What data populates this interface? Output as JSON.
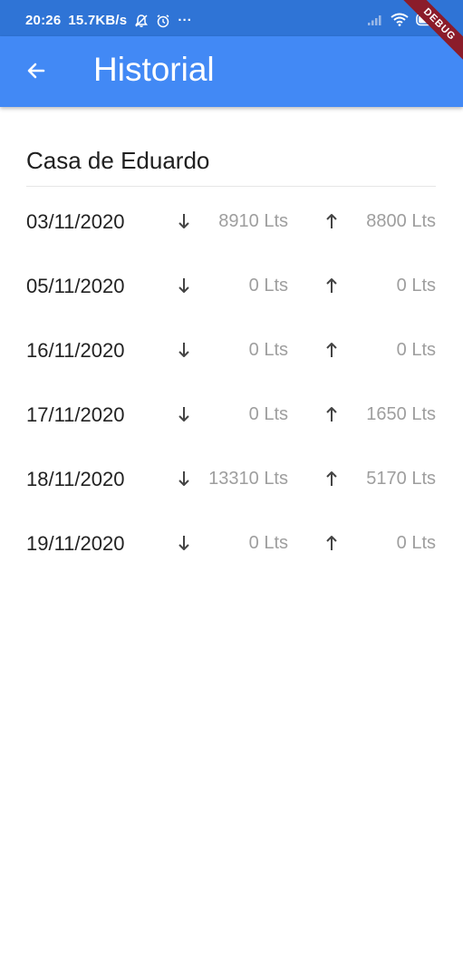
{
  "status_bar": {
    "time": "20:26",
    "speed": "15.7KB/s",
    "more": "···",
    "debug": "DEBUG"
  },
  "app_bar": {
    "title": "Historial",
    "back_icon": "arrow-back-icon",
    "background": "#4289f5"
  },
  "location": {
    "name": "Casa de Eduardo"
  },
  "history": [
    {
      "date": "03/11/2020",
      "in": "8910 Lts",
      "out": "8800 Lts"
    },
    {
      "date": "05/11/2020",
      "in": "0 Lts",
      "out": "0 Lts"
    },
    {
      "date": "16/11/2020",
      "in": "0 Lts",
      "out": "0 Lts"
    },
    {
      "date": "17/11/2020",
      "in": "0 Lts",
      "out": "1650 Lts"
    },
    {
      "date": "18/11/2020",
      "in": "13310 Lts",
      "out": "5170 Lts"
    },
    {
      "date": "19/11/2020",
      "in": "0 Lts",
      "out": "0 Lts"
    }
  ]
}
